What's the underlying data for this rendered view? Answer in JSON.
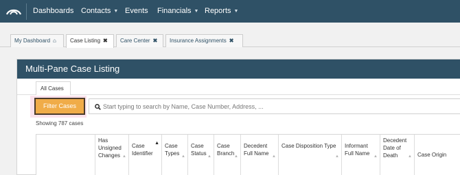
{
  "nav": {
    "items": [
      {
        "label": "Dashboards",
        "dropdown": false
      },
      {
        "label": "Contacts",
        "dropdown": true
      },
      {
        "label": "Events",
        "dropdown": false
      },
      {
        "label": "Financials",
        "dropdown": true
      },
      {
        "label": "Reports",
        "dropdown": true
      }
    ]
  },
  "tabs": [
    {
      "label": "My Dashboard",
      "icon": "home-icon",
      "active": false
    },
    {
      "label": "Case Listing",
      "icon": "close-icon",
      "active": true
    },
    {
      "label": "Care Center",
      "icon": "close-icon",
      "active": false
    },
    {
      "label": "Insurance Assignments",
      "icon": "close-icon",
      "active": false
    }
  ],
  "panel": {
    "title": "Multi-Pane Case Listing",
    "subtab": "All Cases",
    "filter_button": "Filter Cases",
    "search": {
      "value": "",
      "placeholder": "Start typing to search by Name, Case Number, Address, ..."
    },
    "count_text": "Showing 787 cases"
  },
  "table": {
    "columns": [
      {
        "label": ""
      },
      {
        "label": "Has Unsigned Changes",
        "sort": "none"
      },
      {
        "label": "Case Identifier",
        "sort": "asc"
      },
      {
        "label": "Case Types",
        "sort": "none"
      },
      {
        "label": "Case Status",
        "sort": "none"
      },
      {
        "label": "Case Branch",
        "sort": "none"
      },
      {
        "label": "Decedent Full Name",
        "sort": "none"
      },
      {
        "label": "Case Disposition Type",
        "sort": "none"
      },
      {
        "label": "Informant Full Name",
        "sort": "none"
      },
      {
        "label": "Decedent Date of Death",
        "sort": "none"
      },
      {
        "label": "Case Origin",
        "sort": "none"
      }
    ]
  },
  "colors": {
    "navbar": "#2f5166",
    "filter_button": "#f0ac48",
    "filter_highlight": "#fbe2ec"
  }
}
